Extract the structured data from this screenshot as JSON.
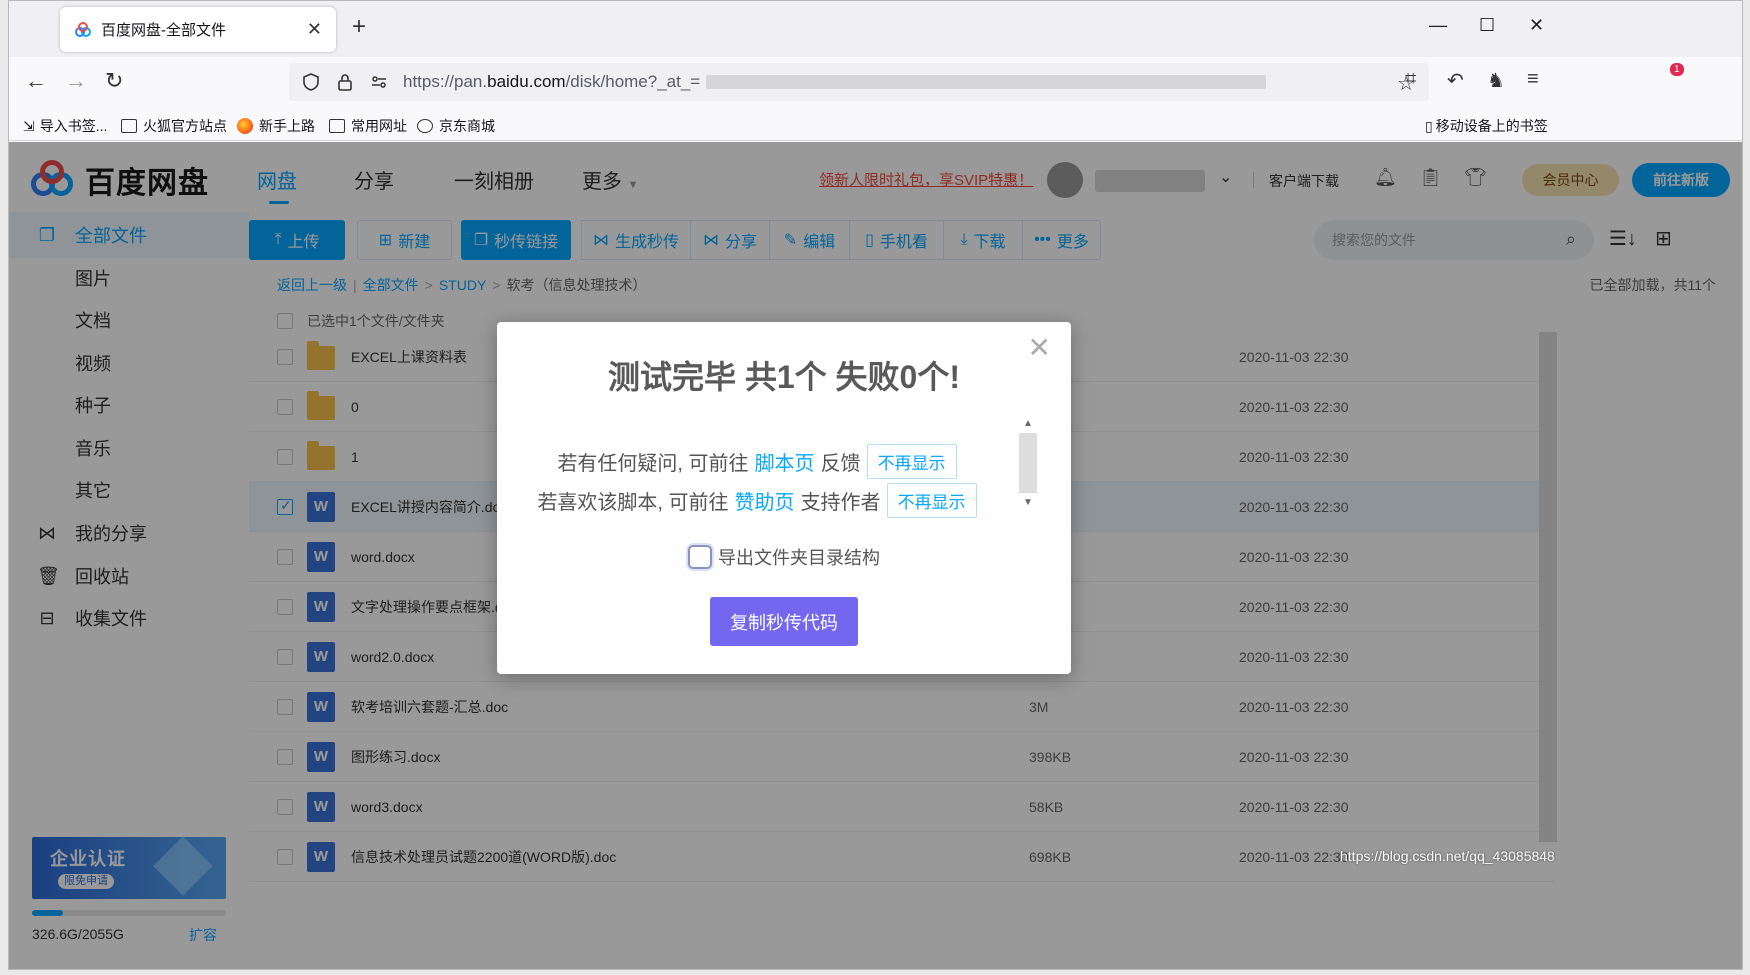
{
  "browser": {
    "tab_title": "百度网盘-全部文件",
    "new_tab": "+",
    "url_prefix": "https://pan.",
    "url_domain": "baidu.com",
    "url_path": "/disk/home?_at_=",
    "notification_count": "1",
    "bookmarks": [
      {
        "label": "导入书签..."
      },
      {
        "label": "火狐官方站点"
      },
      {
        "label": "新手上路"
      },
      {
        "label": "常用网址"
      },
      {
        "label": "京东商城"
      }
    ],
    "mobile_bookmarks": "移动设备上的书签"
  },
  "header": {
    "logo_text": "百度网盘",
    "nav": [
      "网盘",
      "分享",
      "一刻相册",
      "更多"
    ],
    "promo": "领新人限时礼包，享SVIP特惠！",
    "client_download": "客户端下载",
    "vip_center": "会员中心",
    "new_version": "前往新版"
  },
  "sidebar": {
    "items": [
      {
        "label": "全部文件"
      },
      {
        "label": "图片"
      },
      {
        "label": "文档"
      },
      {
        "label": "视频"
      },
      {
        "label": "种子"
      },
      {
        "label": "音乐"
      },
      {
        "label": "其它"
      },
      {
        "label": "我的分享"
      },
      {
        "label": "回收站"
      },
      {
        "label": "收集文件"
      }
    ],
    "enterprise_title": "企业认证",
    "enterprise_sub": "限免申请",
    "quota_used_fraction": 0.16,
    "quota_text": "326.6G/2055G",
    "expand": "扩容"
  },
  "toolbar": {
    "upload": "上传",
    "new": "新建",
    "quick_link": "秒传链接",
    "buttons": [
      "生成秒传",
      "分享",
      "编辑",
      "手机看",
      "下载",
      "更多"
    ],
    "search_placeholder": "搜索您的文件"
  },
  "breadcrumb": {
    "back": "返回上一级",
    "all": "全部文件",
    "study": "STUDY",
    "current": "软考（信息处理技术）",
    "loaded": "已全部加载，共11个"
  },
  "selection_info": "已选中1个文件/文件夹",
  "files": [
    {
      "name": "EXCEL上课资料表",
      "size": "",
      "date": "2020-11-03 22:30"
    },
    {
      "name": "0",
      "size": "",
      "date": "2020-11-03 22:30"
    },
    {
      "name": "1",
      "size": "",
      "date": "2020-11-03 22:30"
    },
    {
      "name": "EXCEL讲授内容简介.docx",
      "size": "",
      "date": "2020-11-03 22:30"
    },
    {
      "name": "word.docx",
      "size": "",
      "date": "2020-11-03 22:30"
    },
    {
      "name": "文字处理操作要点框架.docx",
      "size": "",
      "date": "2020-11-03 22:30"
    },
    {
      "name": "word2.0.docx",
      "size": "",
      "date": "2020-11-03 22:30"
    },
    {
      "name": "软考培训六套题-汇总.doc",
      "size": "3M",
      "date": "2020-11-03 22:30"
    },
    {
      "name": "图形练习.docx",
      "size": "398KB",
      "date": "2020-11-03 22:30"
    },
    {
      "name": "word3.docx",
      "size": "58KB",
      "date": "2020-11-03 22:30"
    },
    {
      "name": "信息技术处理员试题2200道(WORD版).doc",
      "size": "698KB",
      "date": "2020-11-03 22:30"
    }
  ],
  "doc_icon_letter": "W",
  "modal": {
    "title": "测试完毕 共1个 失败0个!",
    "line1_pre": "若有任何疑问, 可前往",
    "line1_link": "脚本页",
    "line1_post": "反馈",
    "line2_pre": "若喜欢该脚本, 可前往",
    "line2_link": "赞助页",
    "line2_post": "支持作者",
    "dont_show": "不再显示",
    "export_label": "导出文件夹目录结构",
    "copy_button": "复制秒传代码"
  },
  "watermark": "https://blog.csdn.net/qq_43085848"
}
